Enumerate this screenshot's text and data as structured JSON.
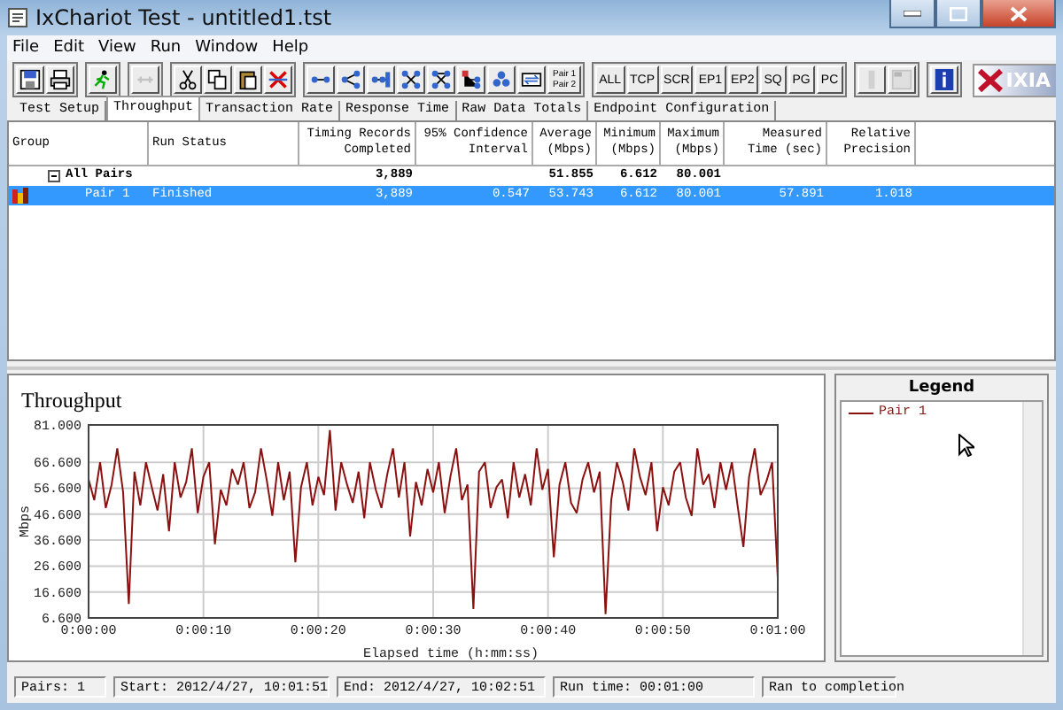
{
  "window": {
    "title": "IxChariot Test - untitled1.tst"
  },
  "menu": [
    "File",
    "Edit",
    "View",
    "Run",
    "Window",
    "Help"
  ],
  "toolbar": [
    [
      {
        "kind": "icon",
        "disabled": false
      },
      {
        "kind": "icon",
        "disabled": false
      }
    ],
    [
      {
        "kind": "icon",
        "disabled": false
      }
    ],
    [
      {
        "kind": "icon",
        "disabled": true
      }
    ],
    [
      {
        "kind": "icon",
        "disabled": false
      },
      {
        "kind": "icon",
        "disabled": false
      },
      {
        "kind": "icon",
        "disabled": false
      },
      {
        "kind": "icon",
        "disabled": false
      }
    ],
    [
      {
        "kind": "icon",
        "disabled": false
      },
      {
        "kind": "icon",
        "disabled": false
      },
      {
        "kind": "icon",
        "disabled": false
      },
      {
        "kind": "icon",
        "disabled": false
      },
      {
        "kind": "icon",
        "disabled": false
      },
      {
        "kind": "icon",
        "disabled": false
      },
      {
        "kind": "icon",
        "disabled": false
      },
      {
        "kind": "icon",
        "disabled": false
      },
      {
        "kind": "pair",
        "lines": [
          "Pair 1",
          "Pair 2"
        ],
        "disabled": false
      }
    ],
    [
      {
        "kind": "text",
        "label": "ALL",
        "disabled": false
      },
      {
        "kind": "text",
        "label": "TCP",
        "disabled": false
      },
      {
        "kind": "text",
        "label": "SCR",
        "disabled": false
      },
      {
        "kind": "text",
        "label": "EP1",
        "disabled": false
      },
      {
        "kind": "text",
        "label": "EP2",
        "disabled": false
      },
      {
        "kind": "text",
        "label": "SQ",
        "disabled": false
      },
      {
        "kind": "text",
        "label": "PG",
        "disabled": false
      },
      {
        "kind": "text",
        "label": "PC",
        "disabled": false
      }
    ],
    [
      {
        "kind": "icon",
        "disabled": true
      },
      {
        "kind": "icon",
        "disabled": true
      }
    ],
    [
      {
        "kind": "icon",
        "disabled": false
      }
    ]
  ],
  "logo": {
    "text": "IXIA"
  },
  "tabs": [
    {
      "label": "Test Setup",
      "selected": false
    },
    {
      "label": "Throughput",
      "selected": true
    },
    {
      "label": "Transaction Rate",
      "selected": false
    },
    {
      "label": "Response Time",
      "selected": false
    },
    {
      "label": "Raw Data Totals",
      "selected": false
    },
    {
      "label": "Endpoint Configuration",
      "selected": false
    }
  ],
  "table": {
    "columns": [
      {
        "lines": [
          "Group"
        ]
      },
      {
        "lines": [
          "Run Status"
        ]
      },
      {
        "lines": [
          "Timing Records",
          "Completed"
        ]
      },
      {
        "lines": [
          "95% Confidence",
          "Interval"
        ]
      },
      {
        "lines": [
          "Average",
          "(Mbps)"
        ]
      },
      {
        "lines": [
          "Minimum",
          "(Mbps)"
        ]
      },
      {
        "lines": [
          "Maximum",
          "(Mbps)"
        ]
      },
      {
        "lines": [
          "Measured",
          "Time (sec)"
        ]
      },
      {
        "lines": [
          "Relative",
          "Precision"
        ]
      }
    ],
    "rows": [
      {
        "kind": "group",
        "expanded": true,
        "selected": false,
        "cells": [
          "All Pairs",
          null,
          "3,889",
          null,
          "51.855",
          "6.612",
          "80.001",
          null,
          null
        ]
      },
      {
        "kind": "pair",
        "selected": true,
        "cells": [
          "Pair 1",
          "Finished",
          "3,889",
          "0.547",
          "53.743",
          "6.612",
          "80.001",
          "57.891",
          "1.018"
        ]
      }
    ]
  },
  "chart": {
    "chart_data": {
      "type": "line",
      "title": "Throughput",
      "ylabel": "Mbps",
      "xlabel": "Elapsed time (h:mm:ss)",
      "xlim": [
        0,
        60
      ],
      "ylim": [
        6.6,
        81
      ],
      "grid": true,
      "x": [
        0,
        0.5,
        1,
        1.5,
        2,
        2.5,
        3,
        3.5,
        4,
        4.5,
        5,
        5.5,
        6,
        6.5,
        7,
        7.5,
        8,
        8.5,
        9,
        9.5,
        10,
        10.5,
        11,
        11.5,
        12,
        12.5,
        13,
        13.5,
        14,
        14.5,
        15,
        15.5,
        16,
        16.5,
        17,
        17.5,
        18,
        18.5,
        19,
        19.5,
        20,
        20.5,
        21,
        21.5,
        22,
        22.5,
        23,
        23.5,
        24,
        24.5,
        25,
        25.5,
        26,
        26.5,
        27,
        27.5,
        28,
        28.5,
        29,
        29.5,
        30,
        30.5,
        31,
        31.5,
        32,
        32.5,
        33,
        33.5,
        34,
        34.5,
        35,
        35.5,
        36,
        36.5,
        37,
        37.5,
        38,
        38.5,
        39,
        39.5,
        40,
        40.5,
        41,
        41.5,
        42,
        42.5,
        43,
        43.5,
        44,
        44.5,
        45,
        45.5,
        46,
        46.5,
        47,
        47.5,
        48,
        48.5,
        49,
        49.5,
        50,
        50.5,
        51,
        51.5,
        52,
        52.5,
        53,
        53.5,
        54,
        54.5,
        55,
        55.5,
        56,
        56.5,
        57,
        57.5,
        58,
        58.5,
        59,
        59.5,
        60
      ],
      "yticks": [
        {
          "value": 81,
          "label": "81.000"
        },
        {
          "value": 66.6,
          "label": "66.600"
        },
        {
          "value": 56.6,
          "label": "56.600"
        },
        {
          "value": 46.6,
          "label": "46.600"
        },
        {
          "value": 36.6,
          "label": "36.600"
        },
        {
          "value": 26.6,
          "label": "26.600"
        },
        {
          "value": 16.6,
          "label": "16.600"
        },
        {
          "value": 6.6,
          "label": "6.600"
        }
      ],
      "xticks": [
        {
          "value": 0,
          "label": "0:00:00"
        },
        {
          "value": 10,
          "label": "0:00:10"
        },
        {
          "value": 20,
          "label": "0:00:20"
        },
        {
          "value": 30,
          "label": "0:00:30"
        },
        {
          "value": 40,
          "label": "0:00:40"
        },
        {
          "value": 50,
          "label": "0:00:50"
        },
        {
          "value": 60,
          "label": "0:01:00"
        }
      ],
      "series": [
        {
          "name": "Pair 1",
          "color": "#8b1010",
          "values": [
            60,
            52,
            66.6,
            49,
            58,
            72,
            55,
            12,
            63,
            50,
            66.6,
            57,
            48,
            62,
            40,
            66.6,
            53,
            59,
            72,
            47,
            61,
            66.6,
            35,
            56,
            50,
            64,
            58,
            66.6,
            49,
            55,
            72,
            60,
            46,
            66.6,
            52,
            63,
            28,
            57,
            66.6,
            50,
            61,
            54,
            79,
            48,
            66.6,
            58,
            51,
            63,
            45,
            66.6,
            56,
            49,
            62,
            72,
            53,
            66.6,
            38,
            59,
            50,
            64,
            55,
            66.6,
            47,
            61,
            72,
            52,
            58,
            10,
            63,
            66.6,
            49,
            57,
            60,
            45,
            66.6,
            53,
            62,
            50,
            72,
            56,
            64,
            30,
            58,
            66.6,
            51,
            47,
            60,
            66.6,
            55,
            63,
            8,
            52,
            66.6,
            59,
            48,
            72,
            61,
            54,
            66.6,
            40,
            57,
            50,
            63,
            66.6,
            53,
            46,
            72,
            58,
            62,
            49,
            66.6,
            56,
            66.6,
            50,
            34,
            61,
            72,
            54,
            59,
            66.6,
            22
          ]
        }
      ]
    }
  },
  "legend": {
    "title": "Legend"
  },
  "status_bar": [
    "Pairs: 1",
    "Start: 2012/4/27, 10:01:51",
    "End: 2012/4/27, 10:02:51",
    "Run time: 00:01:00",
    "Ran to completion"
  ]
}
